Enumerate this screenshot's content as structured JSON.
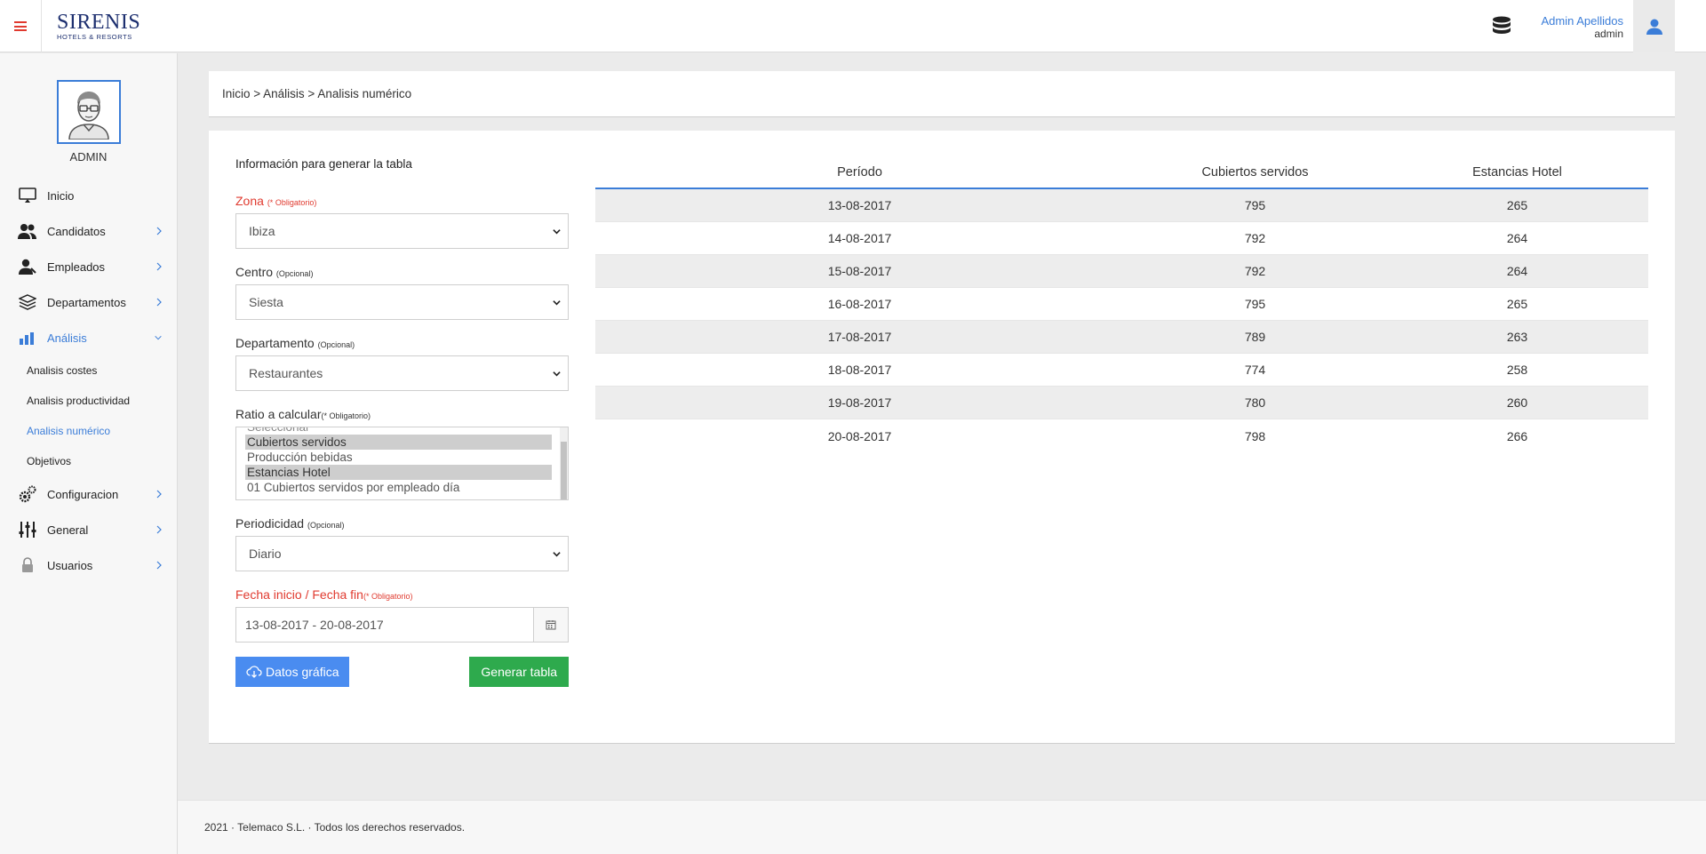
{
  "header": {
    "logo_line1": "SIRENIS",
    "logo_line2": "HOTELS & RESORTS",
    "user_name": "Admin Apellidos",
    "user_role": "admin",
    "icons": [
      "menu-icon",
      "database-icon",
      "user-icon"
    ],
    "accent_color": "#3b7dd8",
    "menu_color": "#e03a2f"
  },
  "sidebar": {
    "profile_label": "ADMIN",
    "items": [
      {
        "label": "Inicio",
        "icon": "monitor-icon"
      },
      {
        "label": "Candidatos",
        "icon": "users-icon"
      },
      {
        "label": "Empleados",
        "icon": "employee-icon"
      },
      {
        "label": "Departamentos",
        "icon": "layers-icon"
      },
      {
        "label": "Análisis",
        "icon": "chart-icon"
      },
      {
        "label": "Configuracion",
        "icon": "gears-icon"
      },
      {
        "label": "General",
        "icon": "sliders-icon"
      },
      {
        "label": "Usuarios",
        "icon": "lock-icon"
      }
    ],
    "analysis_sub": [
      {
        "label": "Analisis costes"
      },
      {
        "label": "Analisis productividad"
      },
      {
        "label": "Analisis numérico"
      },
      {
        "label": "Objetivos"
      }
    ]
  },
  "breadcrumb": "Inicio > Análisis > Analisis numérico",
  "form": {
    "title": "Información para generar la tabla",
    "zona": {
      "label": "Zona",
      "hint": "(* Obligatorio)",
      "value": "Ibiza"
    },
    "centro": {
      "label": "Centro",
      "hint": "(Opcional)",
      "value": "Siesta"
    },
    "departamento": {
      "label": "Departamento",
      "hint": "(Opcional)",
      "value": "Restaurantes"
    },
    "ratio": {
      "label": "Ratio a calcular",
      "hint": "(* Obligatorio)",
      "options": [
        "Seleccionar",
        "Cubiertos servidos",
        "Producción bebidas",
        "Estancias Hotel",
        "01 Cubiertos servidos por empleado día"
      ]
    },
    "periodicidad": {
      "label": "Periodicidad",
      "hint": "(Opcional)",
      "value": "Diario"
    },
    "fecha": {
      "label": "Fecha inicio / Fecha fin",
      "hint": "(* Obligatorio)",
      "value": "13-08-2017 - 20-08-2017"
    },
    "btn_datos": "Datos gráfica",
    "btn_generar": "Generar tabla",
    "btn_blue_color": "#4a8cf0",
    "btn_green_color": "#2eaa4d"
  },
  "table": {
    "columns": [
      "Período",
      "Cubiertos servidos",
      "Estancias Hotel"
    ],
    "rows": [
      [
        "13-08-2017",
        "795",
        "265"
      ],
      [
        "14-08-2017",
        "792",
        "264"
      ],
      [
        "15-08-2017",
        "792",
        "264"
      ],
      [
        "16-08-2017",
        "795",
        "265"
      ],
      [
        "17-08-2017",
        "789",
        "263"
      ],
      [
        "18-08-2017",
        "774",
        "258"
      ],
      [
        "19-08-2017",
        "780",
        "260"
      ],
      [
        "20-08-2017",
        "798",
        "266"
      ]
    ]
  },
  "footer": "2021 · Telemaco S.L. · Todos los derechos reservados."
}
